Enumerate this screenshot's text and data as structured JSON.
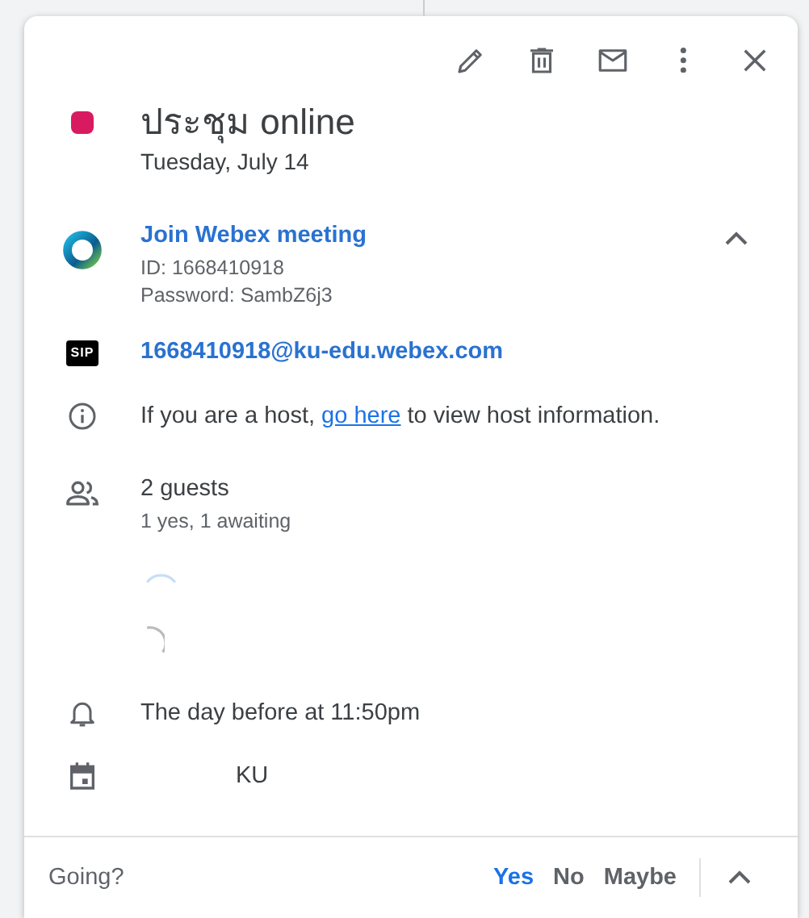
{
  "event": {
    "color": "#d81b60",
    "title": "ประชุม online",
    "date": "Tuesday, July 14"
  },
  "conference": {
    "link": "Join Webex meeting",
    "id": "ID: 1668410918",
    "password": "Password: SambZ6j3",
    "expanded": true
  },
  "sip": {
    "badge": "SIP",
    "address": "1668410918@ku-edu.webex.com"
  },
  "host_info": {
    "before": "If you are a host, ",
    "link": "go here",
    "after": " to view host information."
  },
  "guests": {
    "count": "2 guests",
    "summary": "1 yes, 1 awaiting"
  },
  "reminder": "The day before at 11:50pm",
  "calendar": "KU",
  "rsvp": {
    "prompt": "Going?",
    "options": [
      {
        "label": "Yes",
        "selected": true
      },
      {
        "label": "No",
        "selected": false
      },
      {
        "label": "Maybe",
        "selected": false
      }
    ]
  }
}
